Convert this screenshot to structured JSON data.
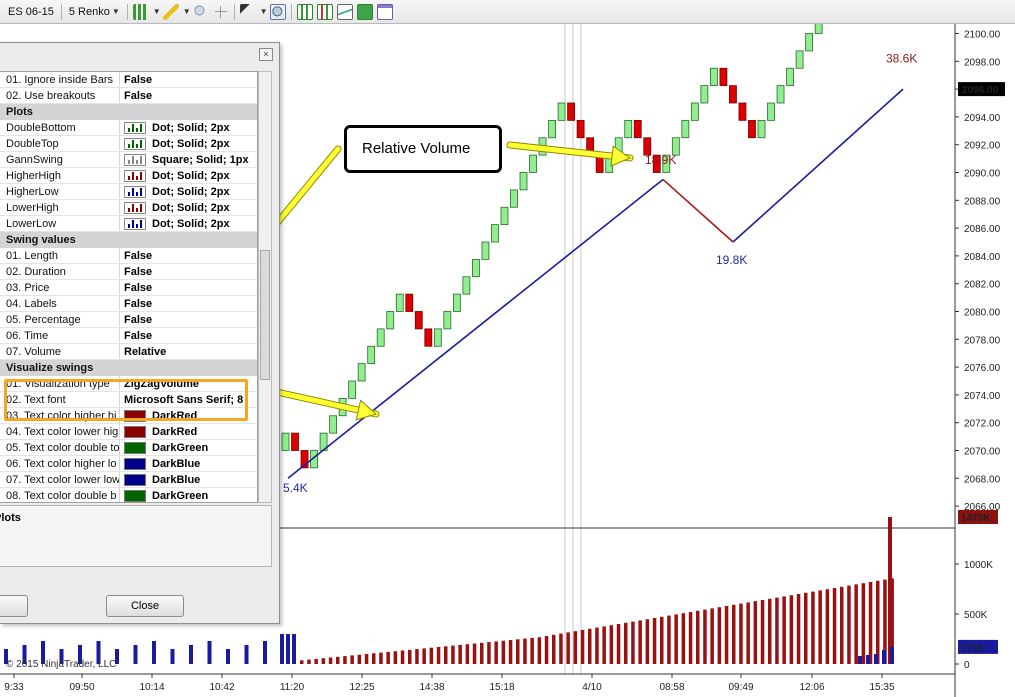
{
  "toolbar": {
    "instrument": "ES 06-15",
    "bar_type": "5 Renko",
    "icons": [
      "bar-style-icon",
      "drawing-pen-icon",
      "zoom-in-icon",
      "pointer-icon",
      "search-icon",
      "indicators-icon",
      "strategies-icon",
      "chart-properties-icon",
      "data-box-icon",
      "templates-icon"
    ]
  },
  "dialog": {
    "rows": [
      {
        "kind": "row",
        "name": "01. Ignore inside Bars",
        "value": "False"
      },
      {
        "kind": "row",
        "name": "02. Use breakouts",
        "value": "False"
      },
      {
        "kind": "cat",
        "name": "Plots"
      },
      {
        "kind": "plot",
        "name": "DoubleBottom",
        "value": "Dot; Solid; 2px",
        "color": "#006400"
      },
      {
        "kind": "plot",
        "name": "DoubleTop",
        "value": "Dot; Solid; 2px",
        "color": "#006400"
      },
      {
        "kind": "plot",
        "name": "GannSwing",
        "value": "Square; Solid; 1px",
        "color": "#888888"
      },
      {
        "kind": "plot",
        "name": "HigherHigh",
        "value": "Dot; Solid; 2px",
        "color": "#8b0000"
      },
      {
        "kind": "plot",
        "name": "HigherLow",
        "value": "Dot; Solid; 2px",
        "color": "#00008b"
      },
      {
        "kind": "plot",
        "name": "LowerHigh",
        "value": "Dot; Solid; 2px",
        "color": "#8b0000"
      },
      {
        "kind": "plot",
        "name": "LowerLow",
        "value": "Dot; Solid; 2px",
        "color": "#00008b"
      },
      {
        "kind": "cat",
        "name": "Swing values"
      },
      {
        "kind": "row",
        "name": "01. Length",
        "value": "False"
      },
      {
        "kind": "row",
        "name": "02. Duration",
        "value": "False"
      },
      {
        "kind": "row",
        "name": "03. Price",
        "value": "False"
      },
      {
        "kind": "row",
        "name": "04. Labels",
        "value": "False"
      },
      {
        "kind": "row",
        "name": "05. Percentage",
        "value": "False"
      },
      {
        "kind": "row",
        "name": "06. Time",
        "value": "False"
      },
      {
        "kind": "row",
        "name": "07. Volume",
        "value": "Relative"
      },
      {
        "kind": "cat",
        "name": "Visualize swings"
      },
      {
        "kind": "row",
        "name": "01. Visualization type",
        "value": "ZigZagVolume"
      },
      {
        "kind": "row",
        "name": "02. Text font",
        "value": "Microsoft Sans Serif; 8"
      },
      {
        "kind": "color",
        "name": "03. Text color higher hi",
        "value": "DarkRed",
        "color": "#8b0000"
      },
      {
        "kind": "color",
        "name": "04. Text color lower hig",
        "value": "DarkRed",
        "color": "#8b0000"
      },
      {
        "kind": "color",
        "name": "05. Text color double to",
        "value": "DarkGreen",
        "color": "#006400"
      },
      {
        "kind": "color",
        "name": "06. Text color higher lo",
        "value": "DarkBlue",
        "color": "#00008b"
      },
      {
        "kind": "color",
        "name": "07. Text color lower low",
        "value": "DarkBlue",
        "color": "#00008b"
      },
      {
        "kind": "color",
        "name": "08. Text color double b",
        "value": "DarkGreen",
        "color": "#006400"
      }
    ],
    "description_title": "Plots",
    "close_label": "Close",
    "close_x": "×"
  },
  "callout": {
    "text": "Relative Volume"
  },
  "copyright": "© 2015 NinjaTrader, LLC",
  "chart": {
    "price_ticks": [
      "2100.00",
      "2098.00",
      "2096.00",
      "2094.00",
      "2092.00",
      "2090.00",
      "2088.00",
      "2086.00",
      "2084.00",
      "2082.00",
      "2080.00",
      "2078.00",
      "2076.00",
      "2074.00",
      "2072.00",
      "2070.00",
      "2068.00",
      "2066.00"
    ],
    "current_price": "2096.00",
    "time_ticks": [
      "9:33",
      "09:50",
      "10:14",
      "10:42",
      "11:20",
      "12:25",
      "14:38",
      "15:18",
      "4/10",
      "08:58",
      "09:49",
      "12:06",
      "15:35"
    ],
    "volume_ticks": [
      "1000K",
      "500K",
      "0"
    ],
    "volume_markers": [
      "1470K",
      "171K"
    ],
    "swing_labels": [
      {
        "text": "5.4K",
        "color": "#1f2a9a"
      },
      {
        "text": "18.9K",
        "color": "#8b1a1a"
      },
      {
        "text": "19.8K",
        "color": "#1f2a9a"
      },
      {
        "text": "38.6K",
        "color": "#8b1a1a"
      }
    ],
    "colors": {
      "up": "#90ee90",
      "down": "#dd0000",
      "zigzag_up": "#1a1aa0",
      "zigzag_down": "#aa1a1a",
      "vol_up": "#9b1010",
      "vol_down": "#1a1aa0",
      "arrow": "#ffff33"
    }
  }
}
